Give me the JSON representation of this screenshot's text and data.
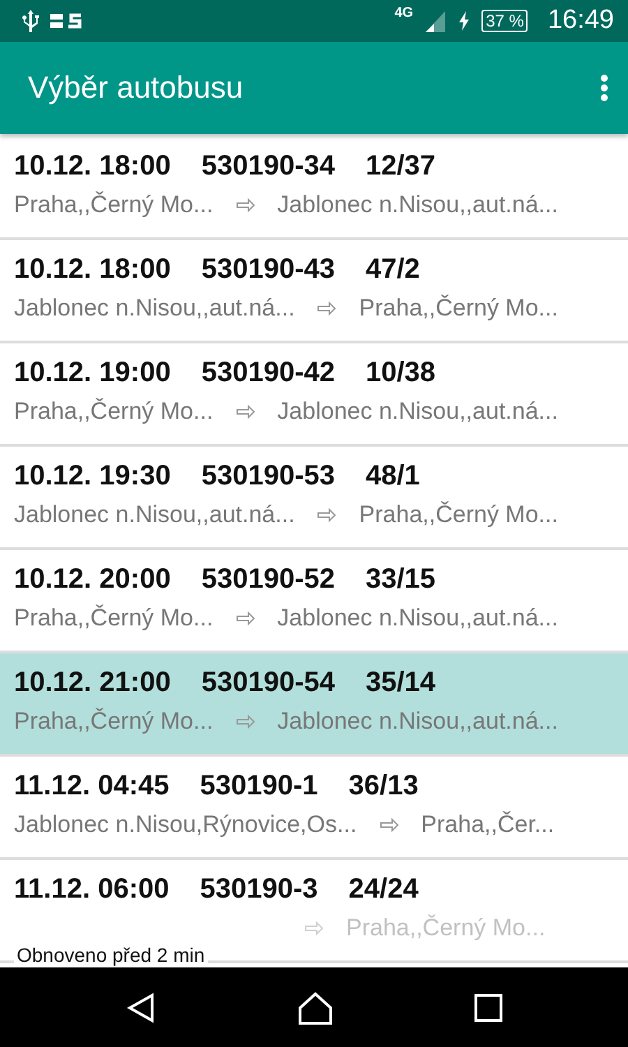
{
  "status_bar": {
    "network": "4G",
    "battery": "37 %",
    "time": "16:49"
  },
  "app_bar": {
    "title": "Výběr autobusu"
  },
  "rows": [
    {
      "date": "10.12.",
      "time": "18:00",
      "bus": "530190-34",
      "seats": "12/37",
      "from": "Praha,,Černý Mo...",
      "to": "Jablonec n.Nisou,,aut.ná...",
      "selected": false
    },
    {
      "date": "10.12.",
      "time": "18:00",
      "bus": "530190-43",
      "seats": "47/2",
      "from": "Jablonec n.Nisou,,aut.ná...",
      "to": "Praha,,Černý Mo...",
      "selected": false
    },
    {
      "date": "10.12.",
      "time": "19:00",
      "bus": "530190-42",
      "seats": "10/38",
      "from": "Praha,,Černý Mo...",
      "to": "Jablonec n.Nisou,,aut.ná...",
      "selected": false
    },
    {
      "date": "10.12.",
      "time": "19:30",
      "bus": "530190-53",
      "seats": "48/1",
      "from": "Jablonec n.Nisou,,aut.ná...",
      "to": "Praha,,Černý Mo...",
      "selected": false
    },
    {
      "date": "10.12.",
      "time": "20:00",
      "bus": "530190-52",
      "seats": "33/15",
      "from": "Praha,,Černý Mo...",
      "to": "Jablonec n.Nisou,,aut.ná...",
      "selected": false
    },
    {
      "date": "10.12.",
      "time": "21:00",
      "bus": "530190-54",
      "seats": "35/14",
      "from": "Praha,,Černý Mo...",
      "to": "Jablonec n.Nisou,,aut.ná...",
      "selected": true
    },
    {
      "date": "11.12.",
      "time": "04:45",
      "bus": "530190-1",
      "seats": "36/13",
      "from": "Jablonec n.Nisou,Rýnovice,Os...",
      "to": "Praha,,Čer...",
      "selected": false
    },
    {
      "date": "11.12.",
      "time": "06:00",
      "bus": "530190-3",
      "seats": "24/24",
      "to": "Praha,,Černý Mo...",
      "selected": false
    }
  ],
  "toast": "Obnoveno před 2 min"
}
